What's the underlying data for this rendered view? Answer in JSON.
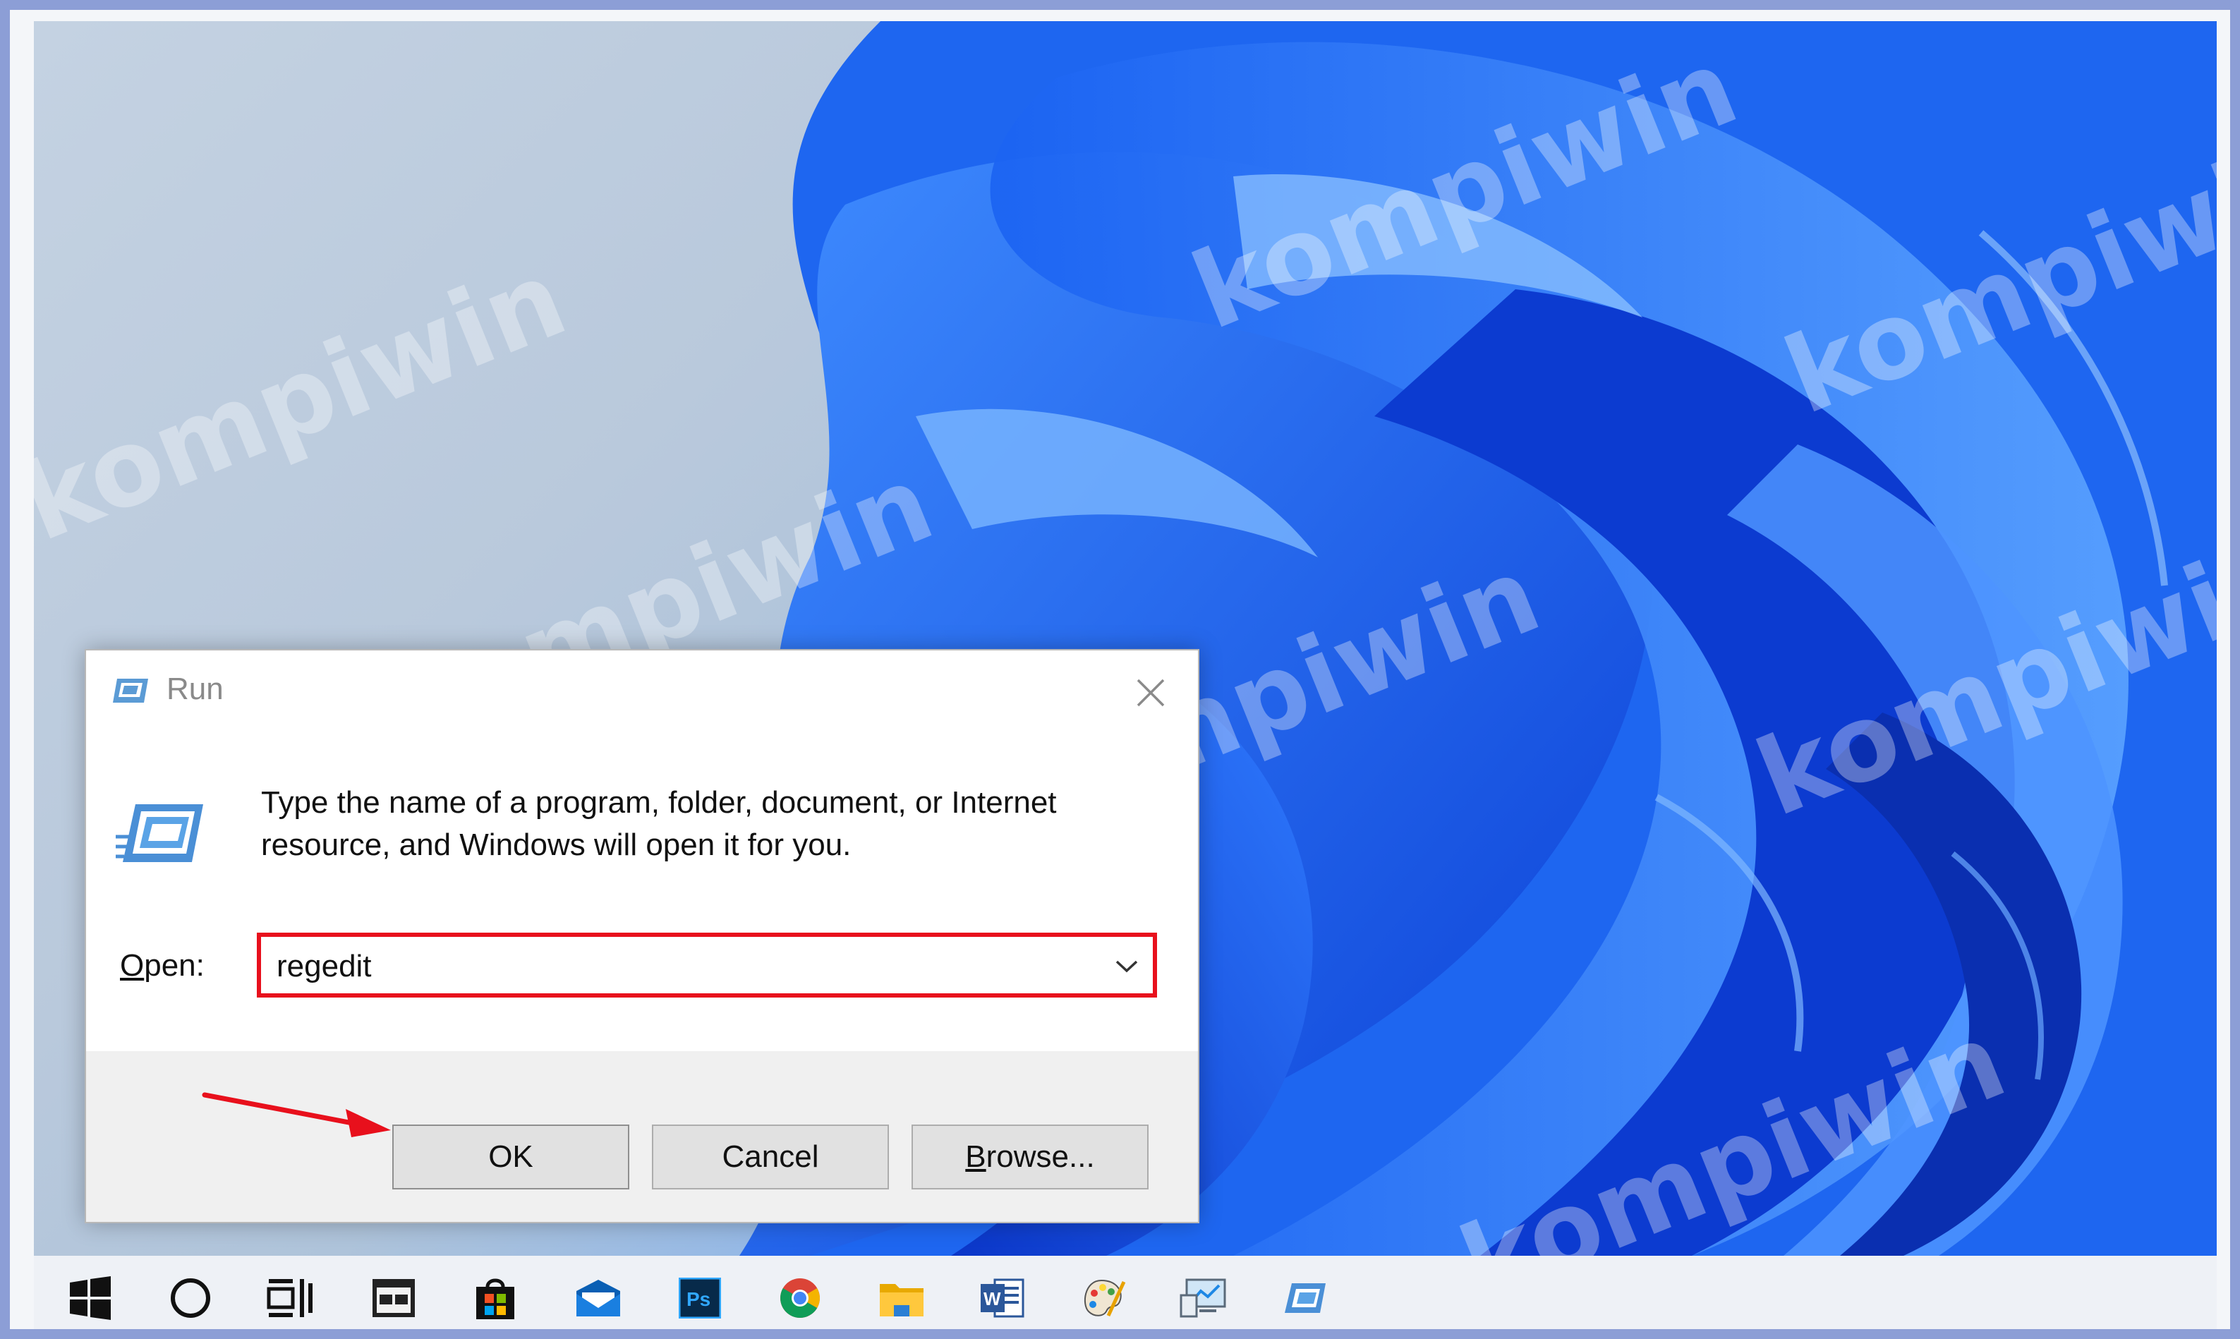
{
  "dialog": {
    "title": "Run",
    "instructions": "Type the name of a program, folder, document, or Internet resource, and Windows will open it for you.",
    "open_label_mnemonic": "O",
    "open_label_rest": "pen:",
    "open_value": "regedit",
    "buttons": {
      "ok": "OK",
      "cancel": "Cancel",
      "browse_mnemonic": "B",
      "browse_rest": "rowse..."
    },
    "highlight_color": "#e8101c"
  },
  "annotation": {
    "arrow_color": "#e8101c"
  },
  "watermark": {
    "text": "kompiwin"
  },
  "taskbar": {
    "items": [
      {
        "icon": "windows-start-icon"
      },
      {
        "icon": "search-circle-icon"
      },
      {
        "icon": "task-view-icon"
      },
      {
        "icon": "terminal-window-icon"
      },
      {
        "icon": "store-bag-icon"
      },
      {
        "icon": "mail-icon"
      },
      {
        "icon": "photoshop-icon",
        "text": "Ps"
      },
      {
        "icon": "chrome-icon"
      },
      {
        "icon": "file-explorer-icon"
      },
      {
        "icon": "word-icon",
        "text": "W"
      },
      {
        "icon": "paint-icon"
      },
      {
        "icon": "remote-desktop-icon"
      },
      {
        "icon": "run-icon"
      }
    ]
  }
}
